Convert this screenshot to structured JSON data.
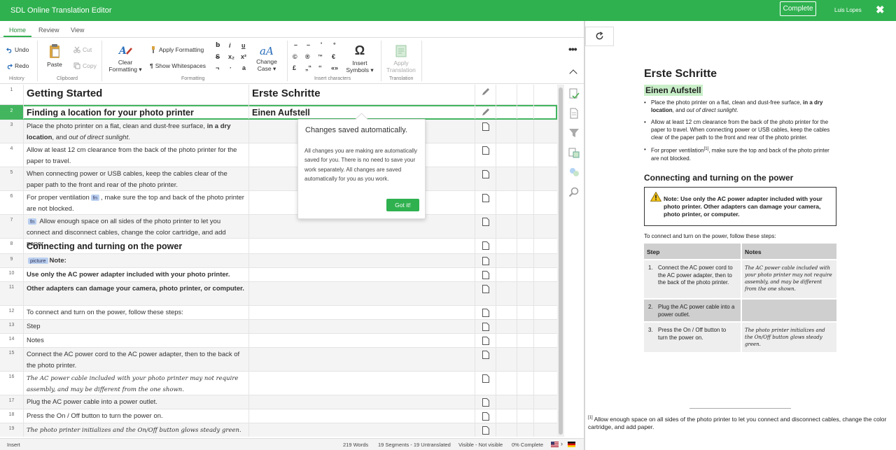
{
  "app": {
    "title": "SDL Online Translation Editor",
    "complete_label": "Complete",
    "user": "Luis Lopes",
    "close_glyph": "✖"
  },
  "tabs": [
    {
      "label": "Home",
      "active": true
    },
    {
      "label": "Review",
      "active": false
    },
    {
      "label": "View",
      "active": false
    }
  ],
  "ribbon": {
    "history": {
      "label": "History",
      "undo": "Undo",
      "redo": "Redo"
    },
    "clipboard": {
      "label": "Clipboard",
      "paste": "Paste",
      "cut": "Cut",
      "copy": "Copy"
    },
    "formatting": {
      "label": "Formatting",
      "clear": "Clear",
      "formatting_word": "Formatting",
      "apply": "Apply Formatting",
      "whitespaces": "Show Whitespaces",
      "change": "Change",
      "case": "Case"
    },
    "insert": {
      "label": "Insert characters",
      "symbols_top": "Insert",
      "symbols_bottom": "Symbols"
    },
    "translation": {
      "label": "Translation",
      "apply_top": "Apply",
      "apply_bottom": "Translation"
    },
    "format_glyphs": [
      "b",
      "i",
      "u",
      "S",
      "x₂",
      "x²",
      "¬",
      "·",
      "a"
    ],
    "char_glyphs": [
      "–",
      "–",
      "'",
      "°",
      "©",
      "®",
      "™",
      "€",
      "£",
      "„“",
      "‘‘",
      "«»"
    ],
    "omega": "Ω",
    "more": "•••"
  },
  "segments": [
    {
      "n": "1",
      "src": "Getting Started",
      "tgt": "Erste Schritte",
      "style": "h1",
      "icon": "pencil"
    },
    {
      "n": "2",
      "src": "Finding a location for your photo printer",
      "tgt": "Einen Aufstell",
      "style": "h2",
      "icon": "pencil",
      "active": true
    },
    {
      "n": "3",
      "src_parts": [
        "Place the photo printer on a flat, clean and dust-free surface, ",
        "in a dry location",
        ", and ",
        "out of direct sunlight",
        "."
      ],
      "icon": "doc"
    },
    {
      "n": "4",
      "src": "Allow at least 12 cm clearance from the back of the photo printer for the paper to travel.",
      "icon": "doc"
    },
    {
      "n": "5",
      "src": "When connecting power or USB cables, keep the cables clear of the paper path to the front and rear of the photo printer.",
      "icon": "doc"
    },
    {
      "n": "6",
      "src_a": "For proper ventilation",
      "tag": "fn",
      "src_b": ", make sure the top and back of the photo printer are not blocked.",
      "icon": "doc"
    },
    {
      "n": "7",
      "tag": "fn",
      "src_b": " Allow enough space on all sides of the photo printer to let you connect and disconnect cables, change the color cartridge, and add paper.",
      "icon": "doc"
    },
    {
      "n": "8",
      "src": "Connecting and turning on the power",
      "style": "h2",
      "icon": "doc"
    },
    {
      "n": "9",
      "tag": "picture",
      "src_b": "Note:",
      "style": "bold",
      "icon": "doc"
    },
    {
      "n": "10",
      "src": "Use only the AC power adapter included with your photo printer.",
      "style": "bold",
      "icon": "doc"
    },
    {
      "n": "11",
      "src": "Other adapters can damage your camera, photo printer, or computer.",
      "style": "bold",
      "icon": "doc"
    },
    {
      "n": "12",
      "src": "To connect and turn on the power, follow these steps:",
      "icon": "doc"
    },
    {
      "n": "13",
      "src": "Step",
      "icon": "doc"
    },
    {
      "n": "14",
      "src": "Notes",
      "icon": "doc"
    },
    {
      "n": "15",
      "src": "Connect the AC power cord to the AC power adapter, then to the back of the photo printer.",
      "icon": "doc"
    },
    {
      "n": "16",
      "src": "The AC power cable included with your photo printer may not require assembly, and may be different from the one shown.",
      "style": "serif-i",
      "icon": "doc"
    },
    {
      "n": "17",
      "src": "Plug the AC power cable into a power outlet.",
      "icon": "doc"
    },
    {
      "n": "18",
      "src": "Press the On / Off button to turn the power on.",
      "icon": "doc"
    },
    {
      "n": "19",
      "src": "The photo printer initializes and the On/Off button glows steady green.",
      "style": "serif-i",
      "icon": "doc"
    }
  ],
  "tooltip": {
    "title": "Changes saved automatically.",
    "body": "All changes you are making are automatically saved for you. There is no need to save your work separately. All changes are saved automatically for you as you work.",
    "button": "Got it!"
  },
  "statusbar": {
    "mode": "Insert",
    "words": "219 Words",
    "segments": "19 Segments - 19 Untranslated",
    "visibility": "Visible - Not visible",
    "percent": "0% Complete"
  },
  "preview": {
    "h1": "Erste Schritte",
    "h2_first": "Einen Aufstell",
    "bullets": [
      {
        "a": "Place the photo printer on a flat, clean and dust-free surface, ",
        "b": "in a dry location",
        "c": ", and ",
        "d": "out of direct sunlight",
        "e": "."
      },
      {
        "a": "Allow at least 12 cm clearance from the back of the photo printer for the paper to travel. When connecting power or USB cables, keep the cables clear of the paper path to the front and rear of the photo printer."
      },
      {
        "a": "For proper ventilation",
        "sup": "[1]",
        "b": ", make sure the top and back of the photo printer are not blocked."
      }
    ],
    "h2_second": "Connecting and turning on the power",
    "note": "Note: Use only the AC power adapter included with your photo printer. Other adapters can damage your camera, photo printer, or computer.",
    "intro": "To connect and turn on the power, follow these steps:",
    "table_head": [
      "Step",
      "Notes"
    ],
    "table_rows": [
      {
        "step": "1.",
        "text": "Connect the AC power cord to the AC power adapter, then to the back of the photo printer.",
        "note": "The AC power cable included with your photo printer may not require assembly, and may be different from the one shown."
      },
      {
        "step": "2.",
        "text": "Plug the AC power cable into a power outlet.",
        "note": ""
      },
      {
        "step": "3.",
        "text": "Press the On / Off button to turn the power on.",
        "note": "The photo printer initializes and the On/Off button glows steady green."
      }
    ],
    "footnote_mark": "[1]",
    "footnote": " Allow enough space on all sides of the photo printer to let you connect and disconnect cables, change the color cartridge, and add paper."
  },
  "colors": {
    "accent": "#2fb14f",
    "active_row": "#43b55f",
    "highlight": "#c9efc9"
  }
}
